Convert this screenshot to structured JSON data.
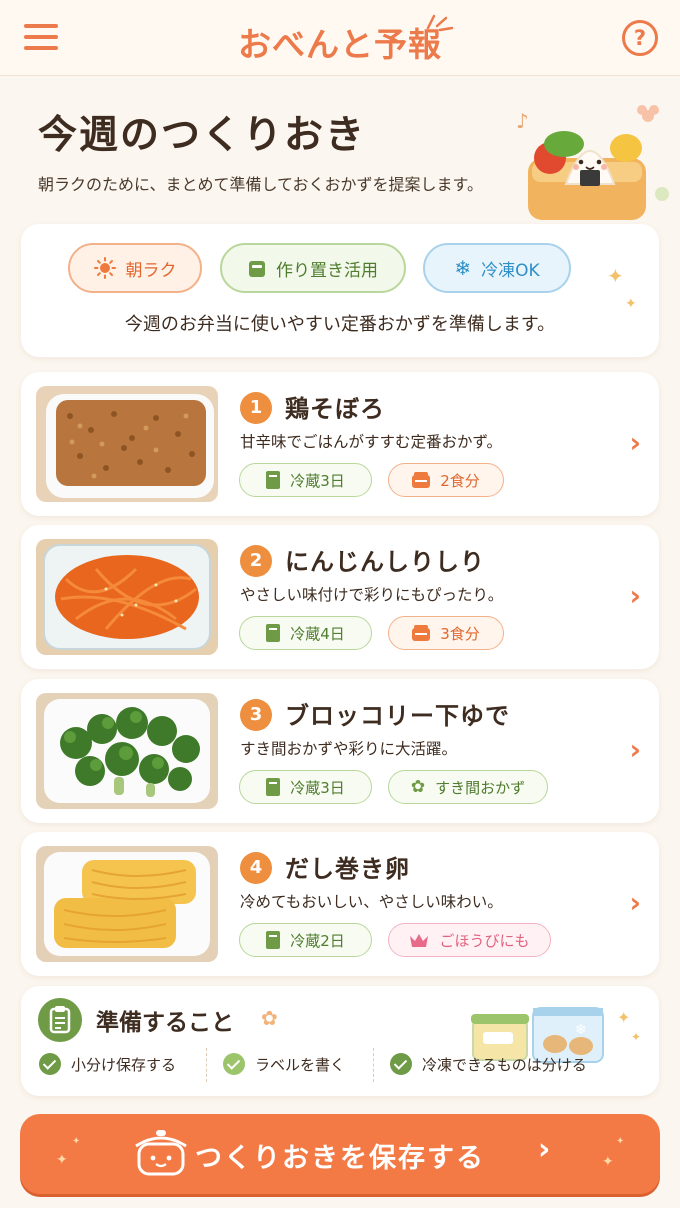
{
  "header": {
    "app_title": "おべんと予報",
    "menu_icon": "hamburger-menu-icon",
    "help_label": "?"
  },
  "hero": {
    "title": "今週のつくりおき",
    "subtitle": "朝ラクのために、まとめて準備しておくおかずを提案します。"
  },
  "intro": {
    "chips": [
      {
        "label": "朝ラク",
        "icon": "sun-icon"
      },
      {
        "label": "作り置き活用",
        "icon": "container-icon"
      },
      {
        "label": "冷凍OK",
        "icon": "snowflake-icon"
      }
    ],
    "text": "今週のお弁当に使いやすい定番おかずを準備します。"
  },
  "recipes": [
    {
      "number": "1",
      "name": "鶏そぼろ",
      "desc": "甘辛味でごはんがすすむ定番おかず。",
      "fridge": "冷蔵3日",
      "extra": "2食分",
      "extra_type": "servings"
    },
    {
      "number": "2",
      "name": "にんじんしりしり",
      "desc": "やさしい味付けで彩りにもぴったり。",
      "fridge": "冷蔵4日",
      "extra": "3食分",
      "extra_type": "servings"
    },
    {
      "number": "3",
      "name": "ブロッコリー下ゆで",
      "desc": "すき間おかずや彩りに大活躍。",
      "fridge": "冷蔵3日",
      "extra": "すき間おかず",
      "extra_type": "gap-filler"
    },
    {
      "number": "4",
      "name": "だし巻き卵",
      "desc": "冷めてもおいしい、やさしい味わい。",
      "fridge": "冷蔵2日",
      "extra": "ごほうびにも",
      "extra_type": "reward"
    }
  ],
  "prep": {
    "title": "準備すること",
    "items": [
      "小分け保存する",
      "ラベルを書く",
      "冷凍できるものは分ける"
    ]
  },
  "cta": {
    "label": "つくりおきを保存する"
  },
  "colors": {
    "accent": "#ec7a4a",
    "green": "#6f9a46",
    "background": "#fbf6ef"
  }
}
